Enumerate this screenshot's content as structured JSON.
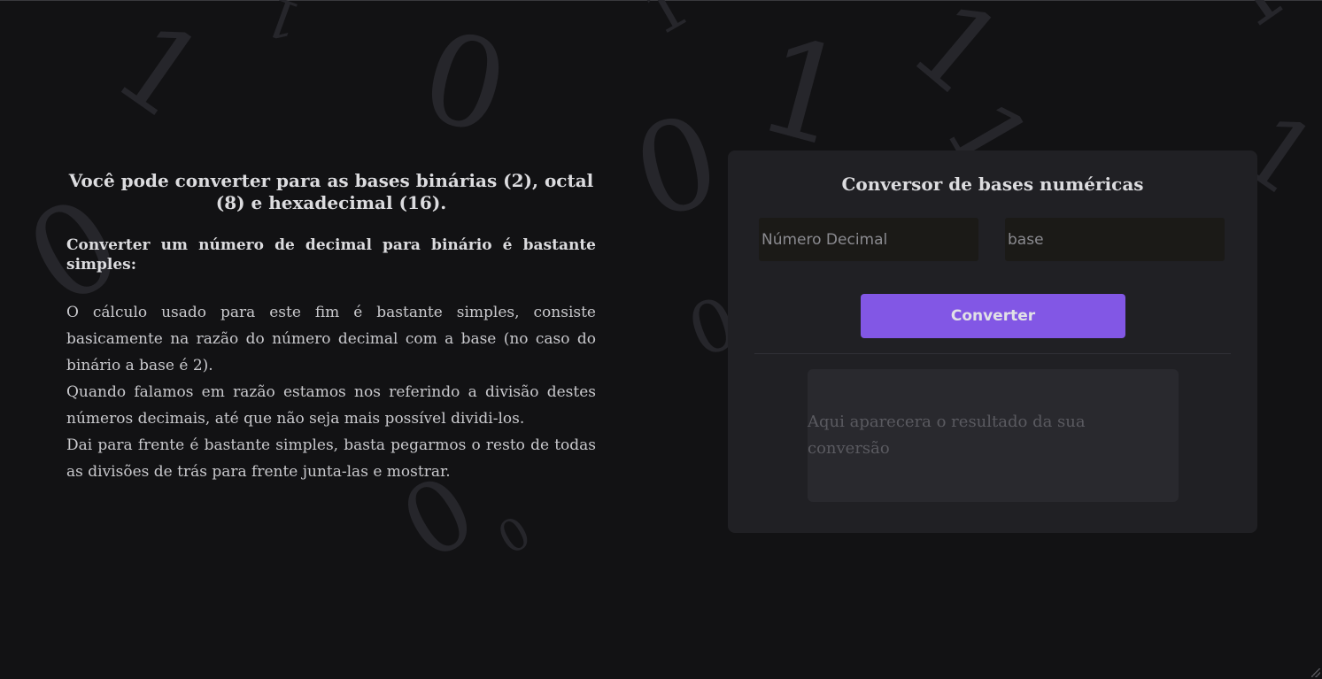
{
  "info": {
    "title": "Você pode converter para as bases binárias (2), octal (8) e hexadecimal (16).",
    "subtitle": "Converter um número de decimal para binário é bastante simples:",
    "paragraphs": [
      "O cálculo usado para este fim é bastante simples, consiste basicamente na razão do número decimal com a base (no caso do binário a base é 2).",
      "Quando falamos em razão estamos nos referindo a divisão destes números decimais, até que não seja mais possível dividi-los.",
      "Dai para frente é bastante simples, basta pegarmos o resto de todas as divisões de trás para frente junta-las e mostrar."
    ]
  },
  "converter": {
    "title": "Conversor de bases numéricas",
    "decimal_placeholder": "Número Decimal",
    "decimal_value": "",
    "base_placeholder": "base",
    "base_value": "",
    "button_label": "Converter",
    "result_placeholder": "Aqui aparecera o resultado da sua conversão"
  },
  "colors": {
    "background": "#121214",
    "card": "#202024",
    "accent": "#8257e5",
    "input": "#1b1a17",
    "result_box": "#29292e"
  }
}
